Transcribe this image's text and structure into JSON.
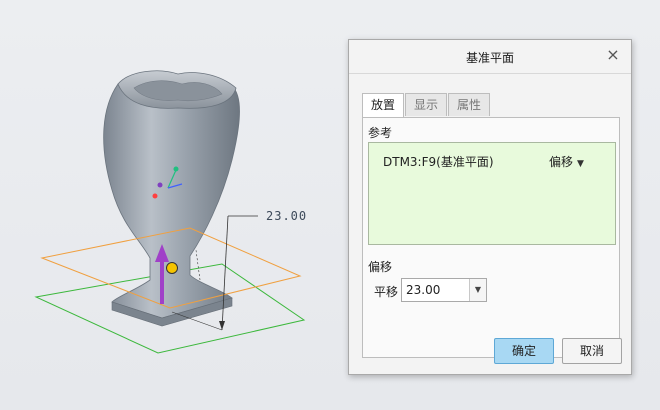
{
  "viewport": {
    "dimension_value": "23.00"
  },
  "dialog": {
    "title": "基准平面",
    "close_symbol": "×",
    "tabs": [
      {
        "label": "放置",
        "active": true
      },
      {
        "label": "显示",
        "active": false
      },
      {
        "label": "属性",
        "active": false
      }
    ],
    "references": {
      "label": "参考",
      "item_name": "DTM3:F9(基准平面)",
      "item_constraint": "偏移"
    },
    "offset": {
      "label": "偏移",
      "translation_label": "平移",
      "translation_value": "23.00"
    },
    "buttons": {
      "ok_label": "确定",
      "cancel_label": "取消"
    }
  },
  "colors": {
    "model_body": "#9aa3ad",
    "orange_plane": "#f0a040",
    "green_plane": "#3cb83c",
    "drag_arrow": "#a040c8",
    "drag_handle": "#f5c400",
    "reference_box": "#e8fadc",
    "ok_button": "#a8d8f3"
  }
}
